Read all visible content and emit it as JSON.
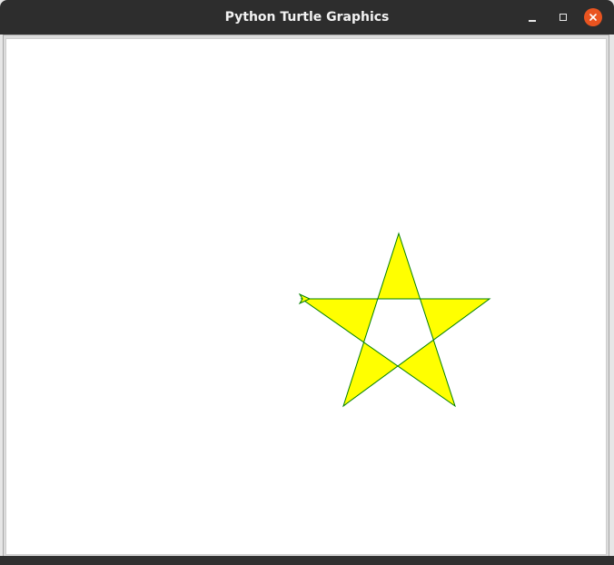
{
  "window": {
    "title": "Python Turtle Graphics"
  },
  "controls": {
    "minimize_icon": "minimize-icon",
    "maximize_icon": "maximize-icon",
    "close_icon": "close-icon"
  },
  "drawing": {
    "shape": "star",
    "points": 5,
    "fill_color": "#ffff00",
    "pen_color": "#008000",
    "turtle_icon": "turtle-arrow-cursor"
  },
  "colors": {
    "titlebar": "#2d2d2d",
    "close_button": "#e95420",
    "canvas": "#ffffff"
  }
}
